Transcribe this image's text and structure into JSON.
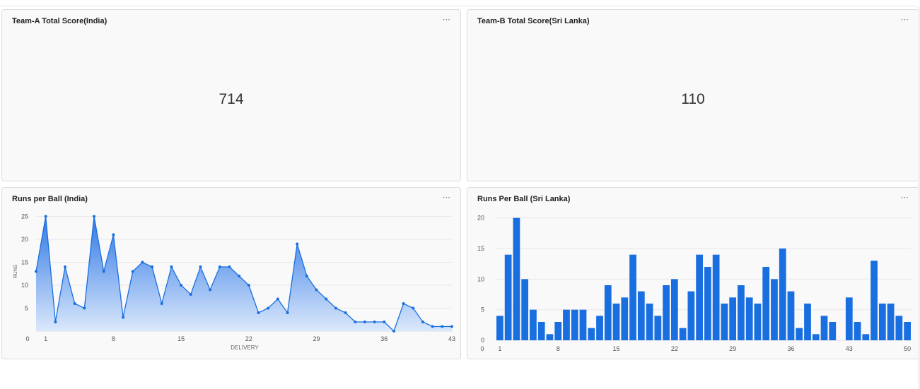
{
  "kpis": {
    "india": {
      "title": "Team-A Total Score(India)",
      "value": "714",
      "menu": "···"
    },
    "srilanka": {
      "title": "Team-B Total Score(Sri Lanka)",
      "value": "110",
      "menu": "···"
    }
  },
  "cards": {
    "india_runs": {
      "title": "Runs per Ball (India)",
      "menu": "···"
    },
    "srilanka_runs": {
      "title": "Runs Per Ball (Sri Lanka)",
      "menu": "···"
    }
  },
  "colors": {
    "accent": "#1a6fe0",
    "area_top": "#2f78e6",
    "area_bottom": "#dbe8fb",
    "grid": "#e8e8e8"
  },
  "chart_data": [
    {
      "type": "area",
      "title": "Runs per Ball (India)",
      "xlabel": "DELIVERY",
      "ylabel": "RUNS",
      "x": [
        0,
        1,
        2,
        3,
        4,
        5,
        6,
        7,
        8,
        9,
        10,
        11,
        12,
        13,
        14,
        15,
        16,
        17,
        18,
        19,
        20,
        21,
        22,
        23,
        24,
        25,
        26,
        27,
        28,
        29,
        30,
        31,
        32,
        33,
        34,
        35,
        36,
        37,
        38,
        39,
        40,
        41,
        42,
        43
      ],
      "values": [
        13,
        25,
        2,
        14,
        6,
        5,
        25,
        13,
        21,
        3,
        13,
        15,
        14,
        6,
        14,
        10,
        8,
        14,
        9,
        14,
        14,
        12,
        10,
        4,
        5,
        7,
        4,
        19,
        12,
        9,
        7,
        5,
        4,
        2,
        2,
        2,
        2,
        0,
        6,
        5,
        2,
        1,
        1,
        1
      ],
      "xticks": [
        "0",
        "1",
        "8",
        "15",
        "22",
        "29",
        "36",
        "43"
      ],
      "xtick_values": [
        0,
        1,
        8,
        15,
        22,
        29,
        36,
        43
      ],
      "yticks": [
        "5",
        "10",
        "15",
        "20",
        "25"
      ],
      "ytick_values": [
        5,
        10,
        15,
        20,
        25
      ],
      "xlim": [
        0,
        43
      ],
      "ylim": [
        0,
        26
      ],
      "grid": true
    },
    {
      "type": "bar",
      "title": "Runs Per Ball (Sri Lanka)",
      "categories": [
        1,
        2,
        3,
        4,
        5,
        6,
        7,
        8,
        9,
        10,
        11,
        12,
        13,
        14,
        15,
        16,
        17,
        18,
        19,
        20,
        21,
        22,
        23,
        24,
        25,
        26,
        27,
        28,
        29,
        30,
        31,
        32,
        33,
        34,
        35,
        36,
        37,
        38,
        39,
        40,
        41,
        42,
        43,
        44,
        45,
        46,
        47,
        48,
        49,
        50
      ],
      "values": [
        4,
        14,
        20,
        10,
        5,
        3,
        1,
        3,
        5,
        5,
        5,
        2,
        4,
        9,
        6,
        7,
        14,
        8,
        6,
        4,
        9,
        10,
        2,
        8,
        14,
        12,
        14,
        6,
        7,
        9,
        7,
        6,
        12,
        10,
        15,
        8,
        2,
        6,
        1,
        4,
        3,
        0,
        7,
        3,
        1,
        13,
        6,
        6,
        4,
        3
      ],
      "xticks": [
        "0",
        "1",
        "8",
        "15",
        "22",
        "29",
        "36",
        "43",
        "50"
      ],
      "xtick_values": [
        0,
        1,
        8,
        15,
        22,
        29,
        36,
        43,
        50
      ],
      "yticks": [
        "0",
        "5",
        "10",
        "15",
        "20"
      ],
      "ytick_values": [
        0,
        5,
        10,
        15,
        20
      ],
      "ylim": [
        0,
        21
      ],
      "grid": true
    }
  ]
}
